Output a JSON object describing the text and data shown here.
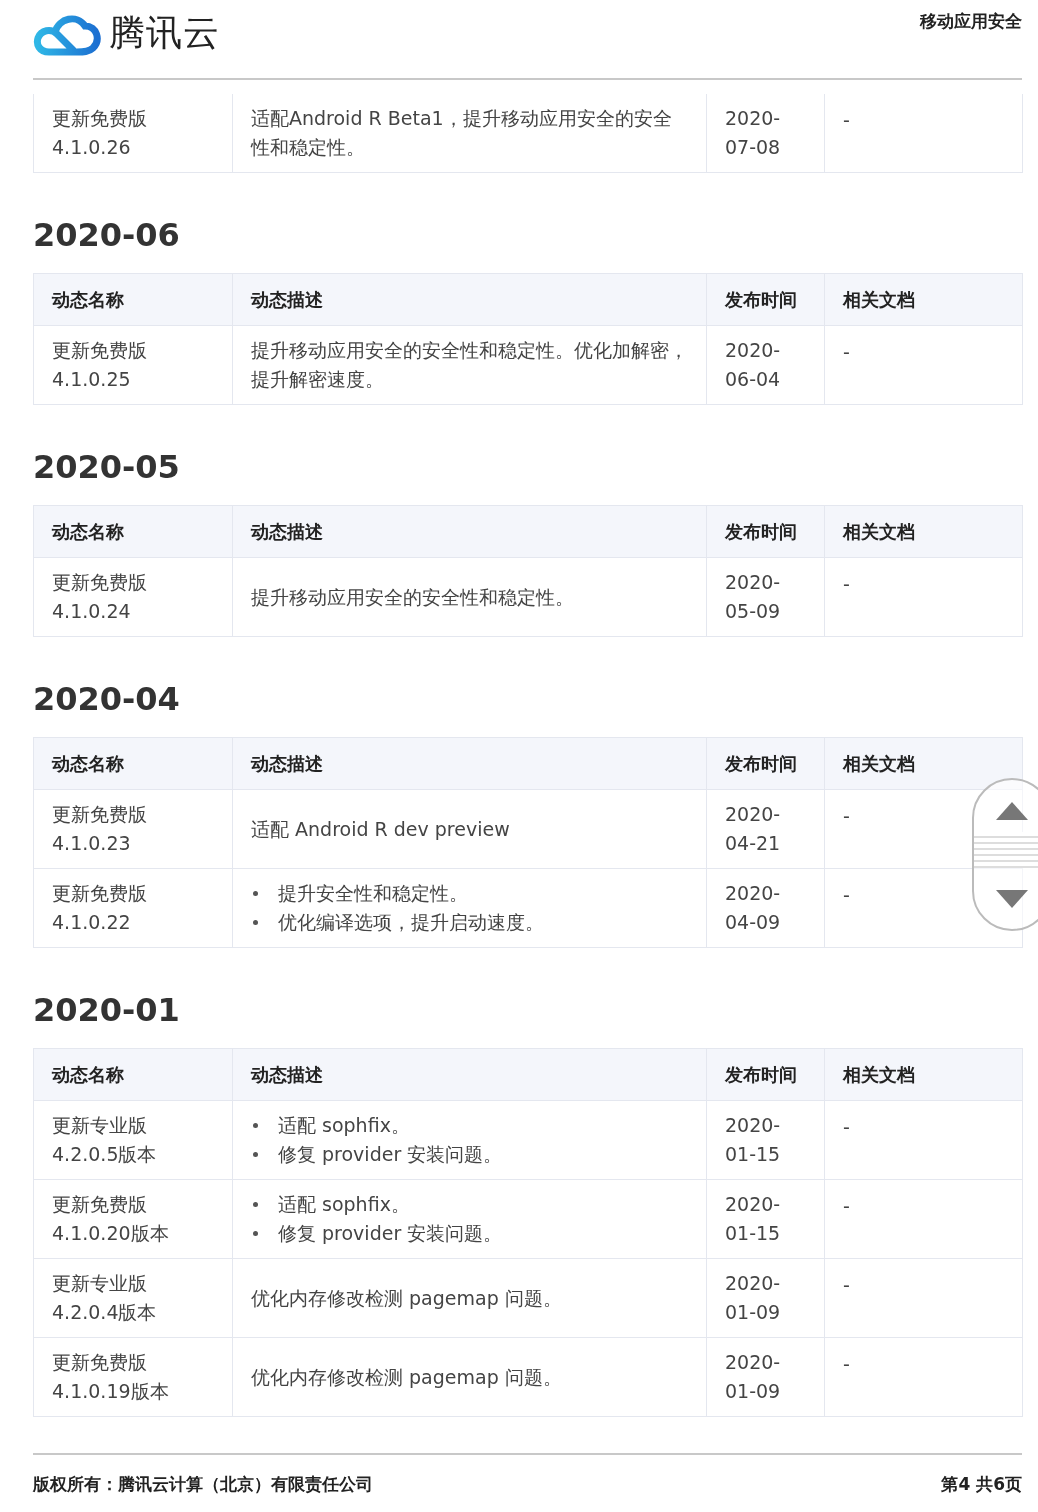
{
  "header": {
    "brand": "腾讯云",
    "product": "移动应用安全"
  },
  "fragment": {
    "rows": [
      {
        "name": [
          "更新免费版",
          "4.1.0.26"
        ],
        "description": {
          "kind": "text",
          "text": "适配Android R Beta1，提升移动应用安全的安全性和稳定性。"
        },
        "date": [
          "2020-",
          "07-08"
        ],
        "doc": "-"
      }
    ]
  },
  "sections": [
    {
      "heading": "2020-06",
      "columns": [
        "动态名称",
        "动态描述",
        "发布时间",
        "相关文档"
      ],
      "rows": [
        {
          "name": [
            "更新免费版",
            "4.1.0.25"
          ],
          "description": {
            "kind": "text",
            "text": "提升移动应用安全的安全性和稳定性。优化加解密，提升解密速度。"
          },
          "date": [
            "2020-",
            "06-04"
          ],
          "doc": "-"
        }
      ]
    },
    {
      "heading": "2020-05",
      "columns": [
        "动态名称",
        "动态描述",
        "发布时间",
        "相关文档"
      ],
      "rows": [
        {
          "name": [
            "更新免费版",
            "4.1.0.24"
          ],
          "description": {
            "kind": "text",
            "text": "提升移动应用安全的安全性和稳定性。"
          },
          "date": [
            "2020-",
            "05-09"
          ],
          "doc": "-"
        }
      ]
    },
    {
      "heading": "2020-04",
      "columns": [
        "动态名称",
        "动态描述",
        "发布时间",
        "相关文档"
      ],
      "rows": [
        {
          "name": [
            "更新免费版",
            "4.1.0.23"
          ],
          "description": {
            "kind": "text",
            "text": "适配 Android R dev preview"
          },
          "date": [
            "2020-",
            "04-21"
          ],
          "doc": "-"
        },
        {
          "name": [
            "更新免费版",
            "4.1.0.22"
          ],
          "description": {
            "kind": "bullets",
            "items": [
              "提升安全性和稳定性。",
              "优化编译选项，提升启动速度。"
            ]
          },
          "date": [
            "2020-",
            "04-09"
          ],
          "doc": "-"
        }
      ]
    },
    {
      "heading": "2020-01",
      "columns": [
        "动态名称",
        "动态描述",
        "发布时间",
        "相关文档"
      ],
      "rows": [
        {
          "name": [
            "更新专业版",
            "4.2.0.5版本"
          ],
          "description": {
            "kind": "bullets",
            "items": [
              "适配 sophfix。",
              "修复 provider 安装问题。"
            ]
          },
          "date": [
            "2020-",
            "01-15"
          ],
          "doc": "-"
        },
        {
          "name": [
            "更新免费版",
            "4.1.0.20版本"
          ],
          "description": {
            "kind": "bullets",
            "items": [
              "适配 sophfix。",
              "修复 provider 安装问题。"
            ]
          },
          "date": [
            "2020-",
            "01-15"
          ],
          "doc": "-"
        },
        {
          "name": [
            "更新专业版",
            "4.2.0.4版本"
          ],
          "description": {
            "kind": "text",
            "text": "优化内存修改检测 pagemap 问题。"
          },
          "date": [
            "2020-",
            "01-09"
          ],
          "doc": "-"
        },
        {
          "name": [
            "更新免费版",
            "4.1.0.19版本"
          ],
          "description": {
            "kind": "text",
            "text": "优化内存修改检测 pagemap 问题。"
          },
          "date": [
            "2020-",
            "01-09"
          ],
          "doc": "-"
        }
      ]
    }
  ],
  "footer": {
    "copyright": "版权所有：腾讯云计算（北京）有限责任公司",
    "page": "第4 共6页"
  }
}
